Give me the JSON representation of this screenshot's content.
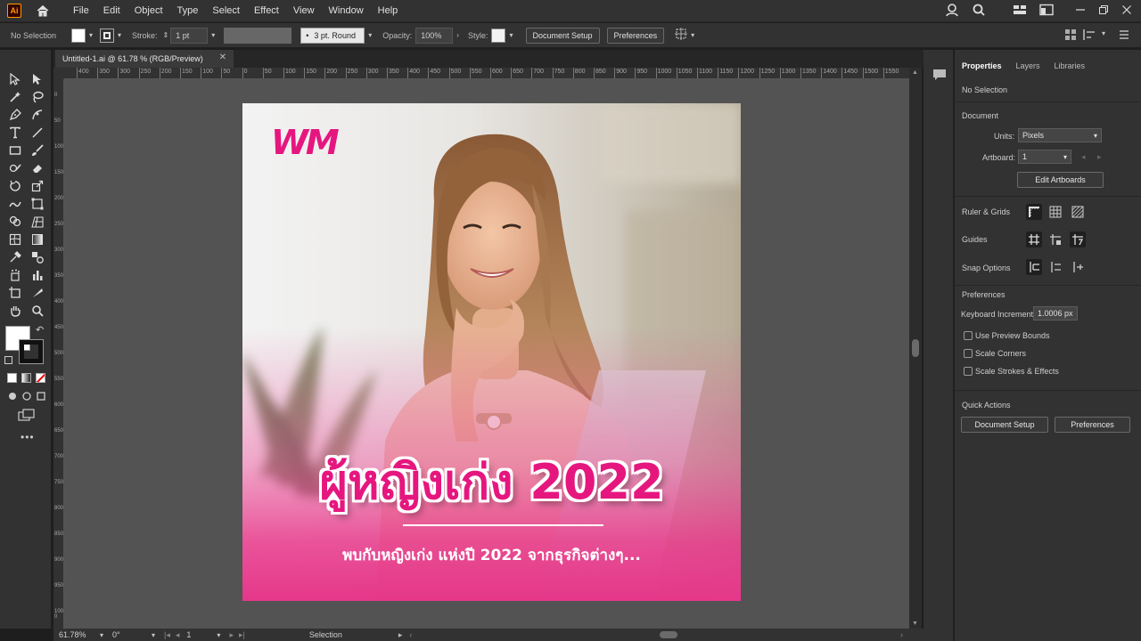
{
  "app": {
    "logo": "Ai",
    "menus": [
      "File",
      "Edit",
      "Object",
      "Type",
      "Select",
      "Effect",
      "View",
      "Window",
      "Help"
    ]
  },
  "control": {
    "selection": "No Selection",
    "stroke_label": "Stroke:",
    "stroke_value": "1 pt",
    "brush": "3 pt. Round",
    "opacity_label": "Opacity:",
    "opacity_value": "100%",
    "style_label": "Style:",
    "document_setup": "Document Setup",
    "preferences": "Preferences"
  },
  "document": {
    "tab_title": "Untitled-1.ai @ 61.78 % (RGB/Preview)"
  },
  "rulers": {
    "top": [
      "400",
      "350",
      "300",
      "250",
      "200",
      "150",
      "100",
      "50",
      "0",
      "50",
      "100",
      "150",
      "200",
      "250",
      "300",
      "350",
      "400",
      "450",
      "500",
      "550",
      "600",
      "650",
      "700",
      "750",
      "800",
      "850",
      "900",
      "950",
      "1000",
      "1050",
      "1100",
      "1150",
      "1200",
      "1250",
      "1300",
      "1350",
      "1400",
      "1450",
      "1500",
      "1550"
    ],
    "left": [
      "0",
      "50",
      "100",
      "150",
      "200",
      "250",
      "300",
      "350",
      "400",
      "450",
      "500",
      "550",
      "600",
      "650",
      "700",
      "750",
      "800",
      "850",
      "900",
      "950",
      "1000"
    ]
  },
  "artwork": {
    "logo": "WM",
    "headline": "ผู้หญิงเก่ง 2022",
    "subtitle": "พบกับหญิงเก่ง แห่งปี 2022 จากธุรกิจต่างๆ...",
    "brand_color": "#e6167f"
  },
  "status": {
    "zoom": "61.78%",
    "rotation": "0°",
    "artboard": "1",
    "tool": "Selection"
  },
  "panel": {
    "tabs": [
      "Properties",
      "Layers",
      "Libraries"
    ],
    "no_selection": "No Selection",
    "document_heading": "Document",
    "units_label": "Units:",
    "units_value": "Pixels",
    "artboard_label": "Artboard:",
    "artboard_value": "1",
    "edit_artboards": "Edit Artboards",
    "ruler_grids": "Ruler & Grids",
    "guides": "Guides",
    "snap_options": "Snap Options",
    "preferences_heading": "Preferences",
    "keyboard_increment_label": "Keyboard Increment:",
    "keyboard_increment_value": "1.0006 px",
    "use_preview_bounds": "Use Preview Bounds",
    "scale_corners": "Scale Corners",
    "scale_strokes": "Scale Strokes & Effects",
    "quick_actions": "Quick Actions",
    "document_setup": "Document Setup",
    "preferences": "Preferences"
  }
}
